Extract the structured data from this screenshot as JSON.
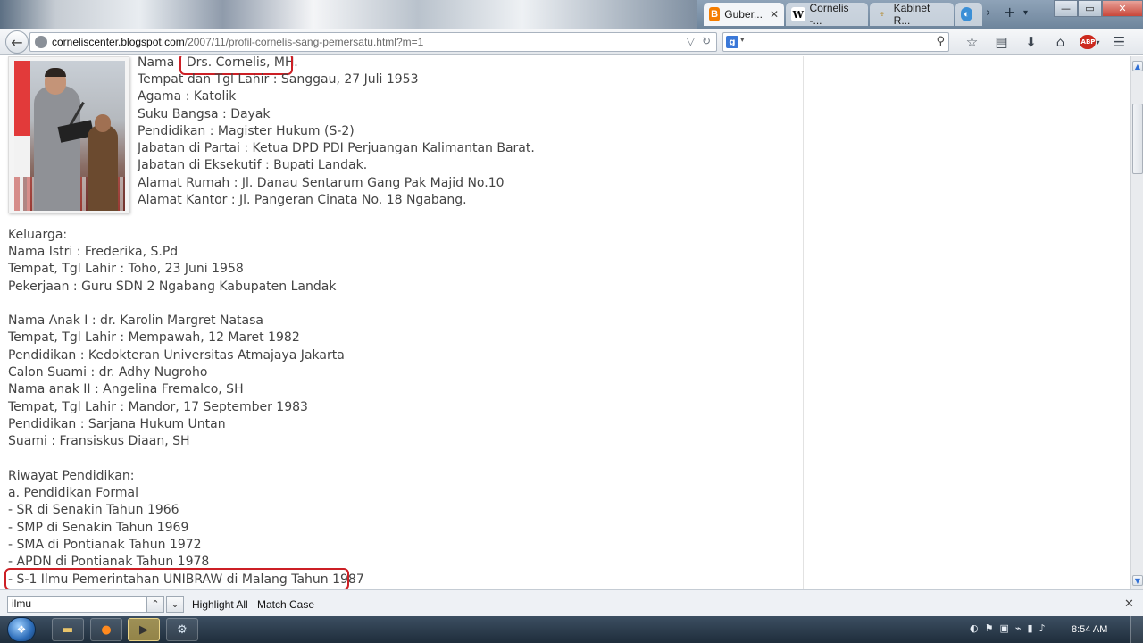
{
  "browser": {
    "tabs": [
      {
        "label": "Guber...",
        "icon": "blogger-icon",
        "active": true,
        "close": "✕"
      },
      {
        "label": "Cornelis -...",
        "icon": "wikipedia-icon",
        "active": false
      },
      {
        "label": "Kabinet R...",
        "icon": "garuda-icon",
        "active": false
      },
      {
        "label": "",
        "icon": "globe-icon",
        "active": false
      }
    ],
    "tab_controls": {
      "scroll": "›",
      "new_tab": "+",
      "list": "▾"
    },
    "window": {
      "minimize": "—",
      "maximize": "▭",
      "close": "✕"
    },
    "url": {
      "host": "corneliscenter.blogspot.com",
      "path": "/2007/11/profil-cornelis-sang-pemersatu.html?m=1"
    },
    "search": {
      "engine_letter": "g",
      "value": ""
    }
  },
  "page": {
    "profile": [
      "Nama : Drs. Cornelis, MH.",
      "Tempat dan Tgl Lahir : Sanggau, 27 Juli 1953",
      "Agama : Katolik",
      "Suku Bangsa : Dayak",
      "Pendidikan : Magister Hukum (S-2)",
      "Jabatan di Partai : Ketua DPD PDI Perjuangan Kalimantan Barat.",
      "Jabatan di Eksekutif : Bupati Landak.",
      "Alamat Rumah : Jl. Danau Sentarum Gang Pak Majid No.10",
      "Alamat Kantor : Jl. Pangeran Cinata No. 18 Ngabang."
    ],
    "family": [
      "Keluarga:",
      "Nama Istri : Frederika, S.Pd",
      "Tempat, Tgl Lahir : Toho, 23 Juni 1958",
      "Pekerjaan : Guru SDN 2 Ngabang Kabupaten Landak"
    ],
    "children": [
      "Nama Anak I : dr. Karolin Margret Natasa",
      "Tempat, Tgl Lahir : Mempawah, 12 Maret 1982",
      "Pendidikan : Kedokteran Universitas Atmajaya Jakarta",
      "Calon Suami : dr. Adhy Nugroho",
      "Nama anak II : Angelina Fremalco, SH",
      "Tempat, Tgl Lahir : Mandor, 17 September 1983",
      "Pendidikan : Sarjana Hukum Untan",
      "Suami : Fransiskus Diaan, SH"
    ],
    "education": [
      "Riwayat Pendidikan:",
      "a. Pendidikan Formal",
      "- SR di Senakin Tahun 1966",
      "- SMP di Senakin Tahun 1969",
      "- SMA di Pontianak Tahun 1972",
      "- APDN di Pontianak Tahun 1978",
      "- S-1 Ilmu Pemerintahan UNIBRAW di Malang Tahun 1987"
    ],
    "highlight_color": "#cc1f25"
  },
  "findbar": {
    "query": "ilmu",
    "highlight_all": "Highlight All",
    "match_case": "Match Case",
    "close": "✕"
  },
  "taskbar": {
    "time": "8:54 AM"
  }
}
